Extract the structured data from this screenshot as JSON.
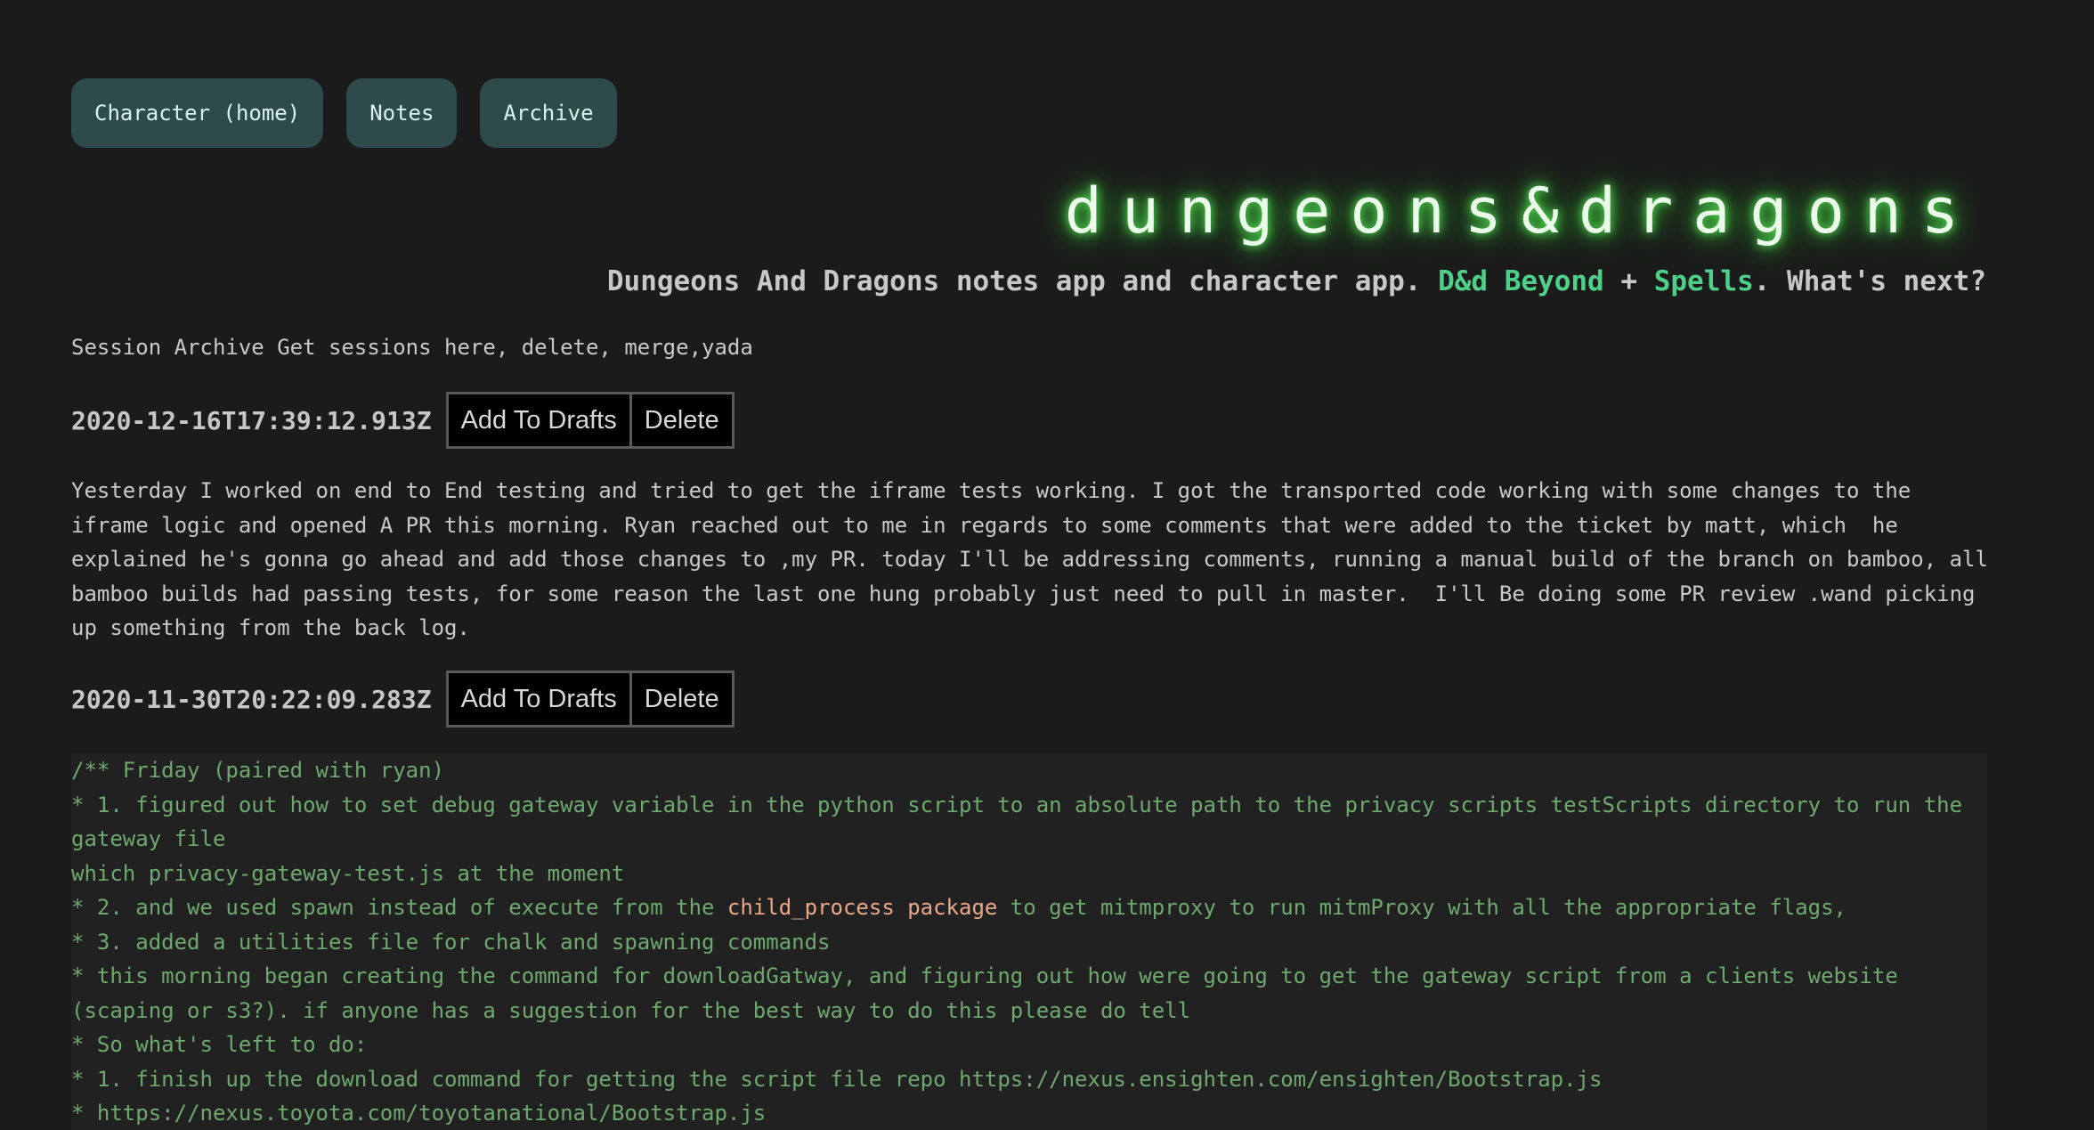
{
  "nav": {
    "items": [
      {
        "label": "Character (home)"
      },
      {
        "label": "Notes"
      },
      {
        "label": "Archive"
      }
    ]
  },
  "header": {
    "logo": "dungeons&dragons",
    "tagline_pre": "Dungeons And Dragons notes app and character app. ",
    "link_ddb": "D&d Beyond",
    "tagline_plus": " + ",
    "link_spells": "Spells",
    "tagline_post": ". What's next?"
  },
  "intro": "Session Archive Get sessions here, delete, merge,yada",
  "sessions": [
    {
      "date": "2020-12-16T17:39:12.913Z",
      "add_label": "Add To Drafts",
      "delete_label": "Delete",
      "text": "Yesterday I worked on end to End testing and tried to get the iframe tests working. I got the transported code working with some changes to the iframe logic and opened A PR this morning. Ryan reached out to me in regards to some comments that were added to the ticket by matt, which  he explained he's gonna go ahead and add those changes to ,my PR. today I'll be addressing comments, running a manual build of the branch on bamboo, all bamboo builds had passing tests, for some reason the last one hung probably just need to pull in master.  I'll Be doing some PR review .wand picking up something from the back log."
    },
    {
      "date": "2020-11-30T20:22:09.283Z",
      "add_label": "Add To Drafts",
      "delete_label": "Delete",
      "lines": {
        "l1": "/** Friday (paired with ryan)",
        "l2": "* 1. figured out how to set debug gateway variable in the python script to an absolute path to the privacy scripts testScripts directory to run the gateway file",
        "l3": "which privacy-gateway-test.js at the moment",
        "l4_pre": "* 2. and we used spawn instead of execute from the ",
        "l4_hl": "child_process package",
        "l4_post": " to get mitmproxy to run mitmProxy with all the appropriate flags,",
        "l5": "* 3. added a utilities file for chalk and spawning commands",
        "l6": "* this morning began creating the command for downloadGatway, and figuring out how were going to get the gateway script from a clients website (scaping or s3?). if anyone has a suggestion for the best way to do this please do tell",
        "l7": "* So what's left to do:",
        "l8": "* 1. finish up the download command for getting the script file repo https://nexus.ensighten.com/ensighten/Bootstrap.js",
        "l9": "* https://nexus.toyota.com/toyotanational/Bootstrap.js"
      }
    }
  ]
}
